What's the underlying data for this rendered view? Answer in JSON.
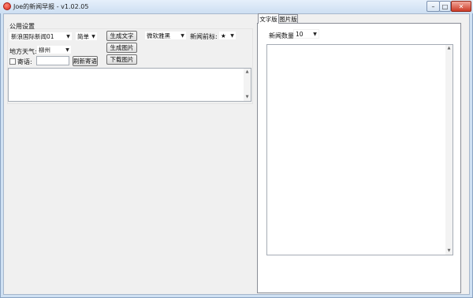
{
  "window": {
    "title": "Joe的新闻早报 - v1.02.05",
    "controls": {
      "minimize": "–",
      "maximize": "□",
      "close": "✕"
    }
  },
  "left_panel": {
    "group_title": "公用设置",
    "source_select": {
      "value": "新浪国际新闻01"
    },
    "script_select": {
      "value": "简单"
    },
    "weather_label": "地方天气:",
    "city_select": {
      "value": "柳州"
    },
    "check_label": "寄语:",
    "refresh_button": "刷新寄语",
    "generate_text_button": "生成文字",
    "generate_image_button": "生成图片",
    "download_image_button": "下载图片",
    "font_select": {
      "value": "微软雅黑"
    },
    "prefix_label": "新闻前标:",
    "prefix_select": {
      "value": "★"
    }
  },
  "right_panel": {
    "tabs": [
      "文字版",
      "图片版"
    ],
    "active_tab": "文字版",
    "count_label": "新闻数量:",
    "count_select": {
      "value": "10"
    }
  },
  "icons": {
    "combo_arrow": "▼",
    "scroll_up": "▲",
    "scroll_down": "▼"
  }
}
